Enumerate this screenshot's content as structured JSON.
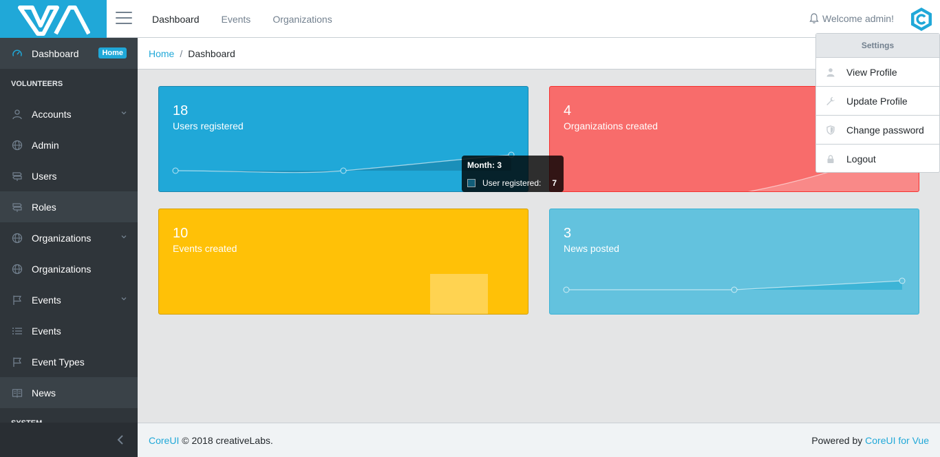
{
  "header": {
    "nav": [
      "Dashboard",
      "Events",
      "Organizations"
    ],
    "welcome": "Welcome admin!"
  },
  "sidebar": {
    "dashboard_label": "Dashboard",
    "dashboard_badge": "Home",
    "section_volunteers": "VOLUNTEERS",
    "items": [
      {
        "label": "Accounts",
        "icon": "user-icon",
        "has_children": true
      },
      {
        "label": "Admin",
        "icon": "globe-icon",
        "has_children": false
      },
      {
        "label": "Users",
        "icon": "signpost-icon",
        "has_children": false
      },
      {
        "label": "Roles",
        "icon": "signpost-icon",
        "has_children": false
      },
      {
        "label": "Organizations",
        "icon": "globe-icon",
        "has_children": true
      },
      {
        "label": "Organizations",
        "icon": "globe-icon",
        "has_children": false
      },
      {
        "label": "Events",
        "icon": "flag-icon",
        "has_children": true
      },
      {
        "label": "Events",
        "icon": "list-icon",
        "has_children": false
      },
      {
        "label": "Event Types",
        "icon": "flag-icon",
        "has_children": false
      },
      {
        "label": "News",
        "icon": "book-icon",
        "has_children": false
      }
    ],
    "section_system": "SYSTEM"
  },
  "breadcrumb": {
    "home": "Home",
    "current": "Dashboard"
  },
  "cards": {
    "users": {
      "value": "18",
      "label": "Users registered",
      "color": "#20a8d8"
    },
    "organizations": {
      "value": "4",
      "label": "Organizations created",
      "color": "#f86c6b"
    },
    "events": {
      "value": "10",
      "label": "Events created",
      "color": "#ffc107"
    },
    "news": {
      "value": "3",
      "label": "News posted",
      "color": "#63c2de"
    }
  },
  "tooltip": {
    "title": "Month: 3",
    "label": "User registered:",
    "value": "7"
  },
  "dropdown": {
    "header": "Settings",
    "items": [
      {
        "label": "View Profile",
        "icon": "user-icon"
      },
      {
        "label": "Update Profile",
        "icon": "wrench-icon"
      },
      {
        "label": "Change password",
        "icon": "shield-icon"
      },
      {
        "label": "Logout",
        "icon": "lock-icon"
      }
    ]
  },
  "footer": {
    "brand": "CoreUI",
    "copyright": "© 2018 creativeLabs.",
    "powered_by": "Powered by",
    "powered_link": "CoreUI for Vue"
  }
}
